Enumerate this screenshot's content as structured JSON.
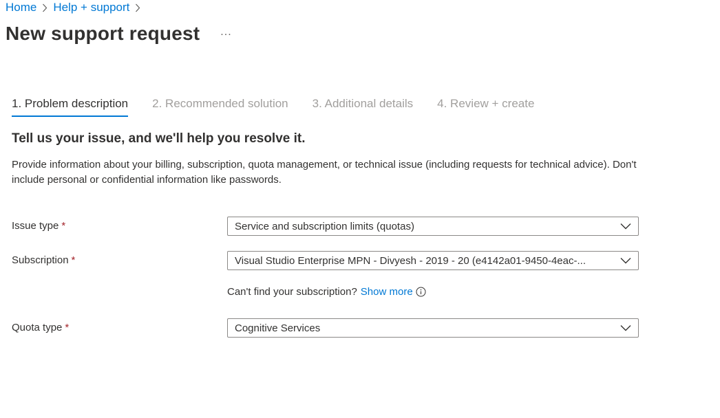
{
  "breadcrumb": {
    "items": [
      "Home",
      "Help + support"
    ]
  },
  "header": {
    "title": "New support request",
    "more_label": "..."
  },
  "tabs": [
    {
      "label": "1. Problem description",
      "active": true
    },
    {
      "label": "2. Recommended solution",
      "active": false
    },
    {
      "label": "3. Additional details",
      "active": false
    },
    {
      "label": "4. Review + create",
      "active": false
    }
  ],
  "section": {
    "heading": "Tell us your issue, and we'll help you resolve it.",
    "description": "Provide information about your billing, subscription, quota management, or technical issue (including requests for technical advice). Don't include personal or confidential information like passwords."
  },
  "form": {
    "issue_type": {
      "label": "Issue type",
      "required_mark": "*",
      "value": "Service and subscription limits (quotas)"
    },
    "subscription": {
      "label": "Subscription",
      "required_mark": "*",
      "value": "Visual Studio Enterprise MPN - Divyesh - 2019 - 20 (e4142a01-9450-4eac-...",
      "helper_text": "Can't find your subscription?",
      "helper_link": "Show more"
    },
    "quota_type": {
      "label": "Quota type",
      "required_mark": "*",
      "value": "Cognitive Services"
    }
  },
  "colors": {
    "accent": "#0078d4",
    "required": "#a4262c",
    "text": "#323130",
    "inactive_tab": "#a19f9d",
    "border": "#8a8886"
  },
  "icons": {
    "breadcrumb_separator": "chevron-right-icon",
    "dropdown": "chevron-down-icon",
    "info": "info-icon"
  }
}
